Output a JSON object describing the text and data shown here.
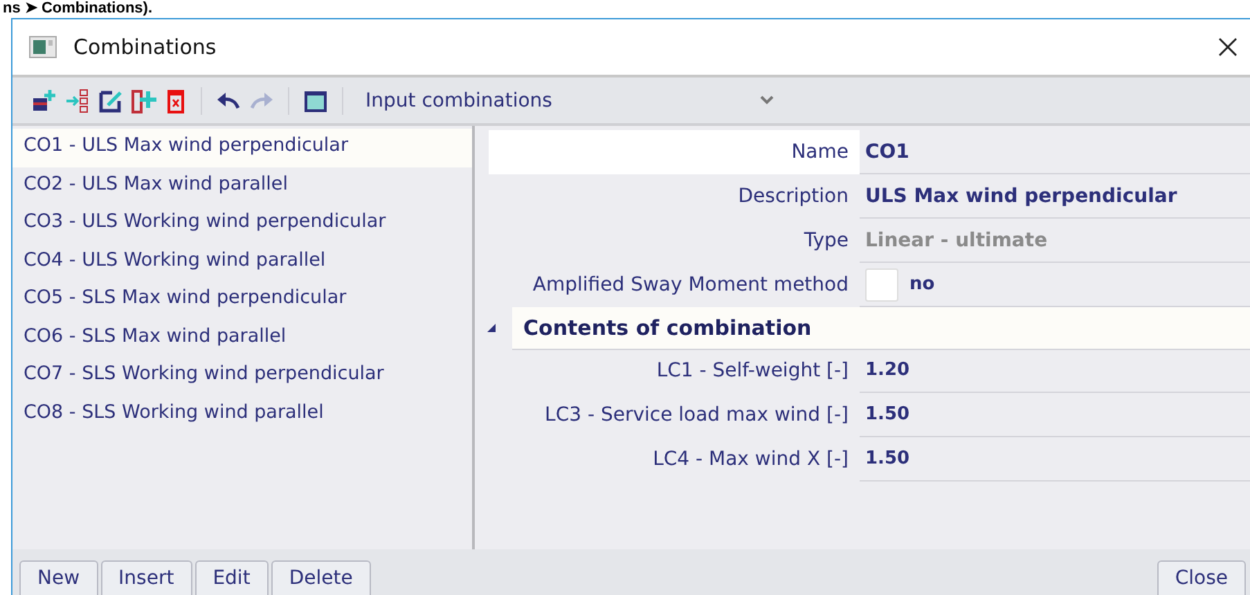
{
  "page_heading": "ns ➤ Combinations).",
  "window": {
    "title": "Combinations"
  },
  "toolbar": {
    "dropdown": {
      "value": "Input combinations"
    }
  },
  "combinations": [
    {
      "label": "CO1 - ULS Max wind perpendicular",
      "selected": true
    },
    {
      "label": "CO2 - ULS Max wind parallel",
      "selected": false
    },
    {
      "label": "CO3 - ULS Working wind perpendicular",
      "selected": false
    },
    {
      "label": "CO4 - ULS Working wind parallel",
      "selected": false
    },
    {
      "label": "CO5 - SLS Max wind perpendicular",
      "selected": false
    },
    {
      "label": "CO6 - SLS Max wind parallel",
      "selected": false
    },
    {
      "label": "CO7 - SLS Working wind perpendicular",
      "selected": false
    },
    {
      "label": "CO8 - SLS Working wind parallel",
      "selected": false
    }
  ],
  "properties": [
    {
      "kind": "text",
      "label": "Name",
      "value": "CO1",
      "disabled": false,
      "selected": true
    },
    {
      "kind": "text",
      "label": "Description",
      "value": "ULS Max wind perpendicular",
      "disabled": false,
      "selected": false
    },
    {
      "kind": "text",
      "label": "Type",
      "value": "Linear - ultimate",
      "disabled": true,
      "selected": false
    },
    {
      "kind": "checkbox",
      "label": "Amplified Sway Moment method",
      "value": "no",
      "checked": false,
      "selected": false
    }
  ],
  "section": {
    "title": "Contents of combination",
    "expanded": true,
    "rows": [
      {
        "label": "LC1 - Self-weight [-]",
        "value": "1.20"
      },
      {
        "label": "LC3 - Service load max wind [-]",
        "value": "1.50"
      },
      {
        "label": "LC4 - Max wind X [-]",
        "value": "1.50"
      }
    ]
  },
  "buttons": [
    "New",
    "Insert",
    "Edit",
    "Delete"
  ],
  "close_button": "Close"
}
